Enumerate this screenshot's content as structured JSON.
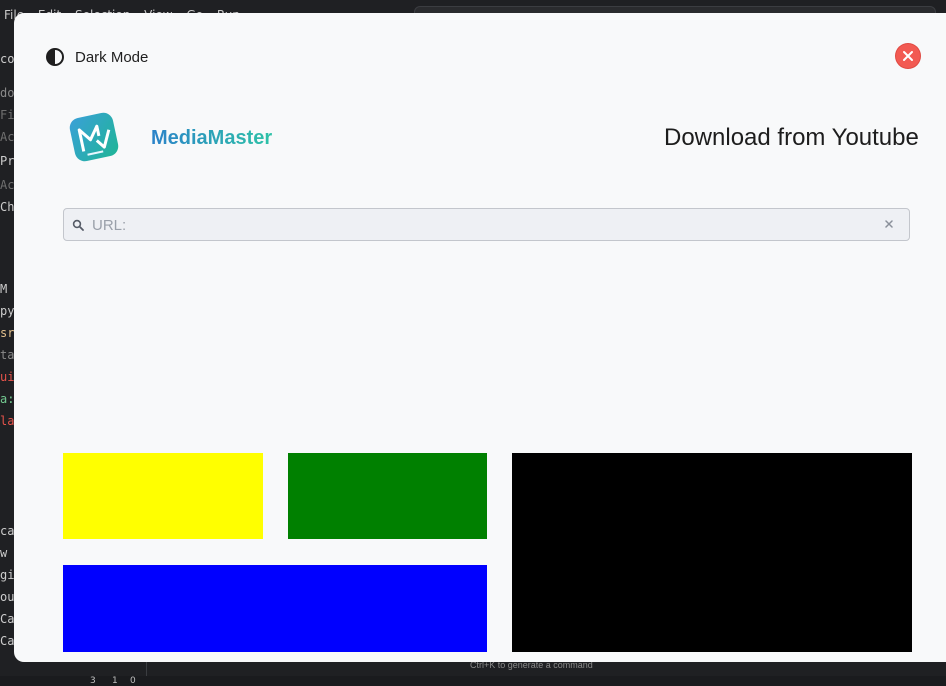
{
  "ide": {
    "menu": [
      "File",
      "Edit",
      "Selection",
      "View",
      "Go",
      "Run"
    ],
    "sidebar_fragments": [
      {
        "text": "co",
        "color": "#cccccc"
      },
      {
        "text": "do",
        "color": "#8a8a8a"
      },
      {
        "text": "Fil",
        "color": "#6f6f6f"
      },
      {
        "text": "Ac",
        "color": "#6f6f6f"
      },
      {
        "text": "Pr",
        "color": "#cccccc"
      },
      {
        "text": "Ac",
        "color": "#6f6f6f"
      },
      {
        "text": "Ch",
        "color": "#cccccc"
      },
      {
        "text": "M",
        "color": "#cccccc"
      },
      {
        "text": "py",
        "color": "#cccccc"
      },
      {
        "text": "src",
        "color": "#e2c08d"
      },
      {
        "text": "tar",
        "color": "#8a8a8a"
      },
      {
        "text": "ui",
        "color": "#e5534b"
      },
      {
        "text": "a:",
        "color": "#73c991"
      },
      {
        "text": "la",
        "color": "#e5534b"
      },
      {
        "text": "ca",
        "color": "#cccccc"
      },
      {
        "text": "w",
        "color": "#cccccc"
      },
      {
        "text": "gi",
        "color": "#cccccc"
      },
      {
        "text": "ou",
        "color": "#cccccc"
      },
      {
        "text": "Ca",
        "color": "#cccccc"
      },
      {
        "text": "Ca",
        "color": "#cccccc"
      }
    ],
    "command_hint": "Ctrl+K to generate a command",
    "status": [
      "0",
      "3",
      "1"
    ]
  },
  "app": {
    "dark_mode_label": "Dark Mode",
    "brand_name": "MediaMaster",
    "headline": "Download from Youtube",
    "url_placeholder": "URL:",
    "url_value": "",
    "colors": {
      "brand_gradient_start": "#2b82c9",
      "brand_gradient_end": "#2ec2a7",
      "close_button": "#f25a52",
      "tile_yellow": "#ffff00",
      "tile_green": "#008000",
      "tile_blue": "#0000ff",
      "tile_black": "#000000"
    },
    "icons": {
      "dark_mode": "half-circle-contrast-icon",
      "close": "close-icon",
      "search": "search-icon",
      "clear": "clear-icon"
    }
  }
}
